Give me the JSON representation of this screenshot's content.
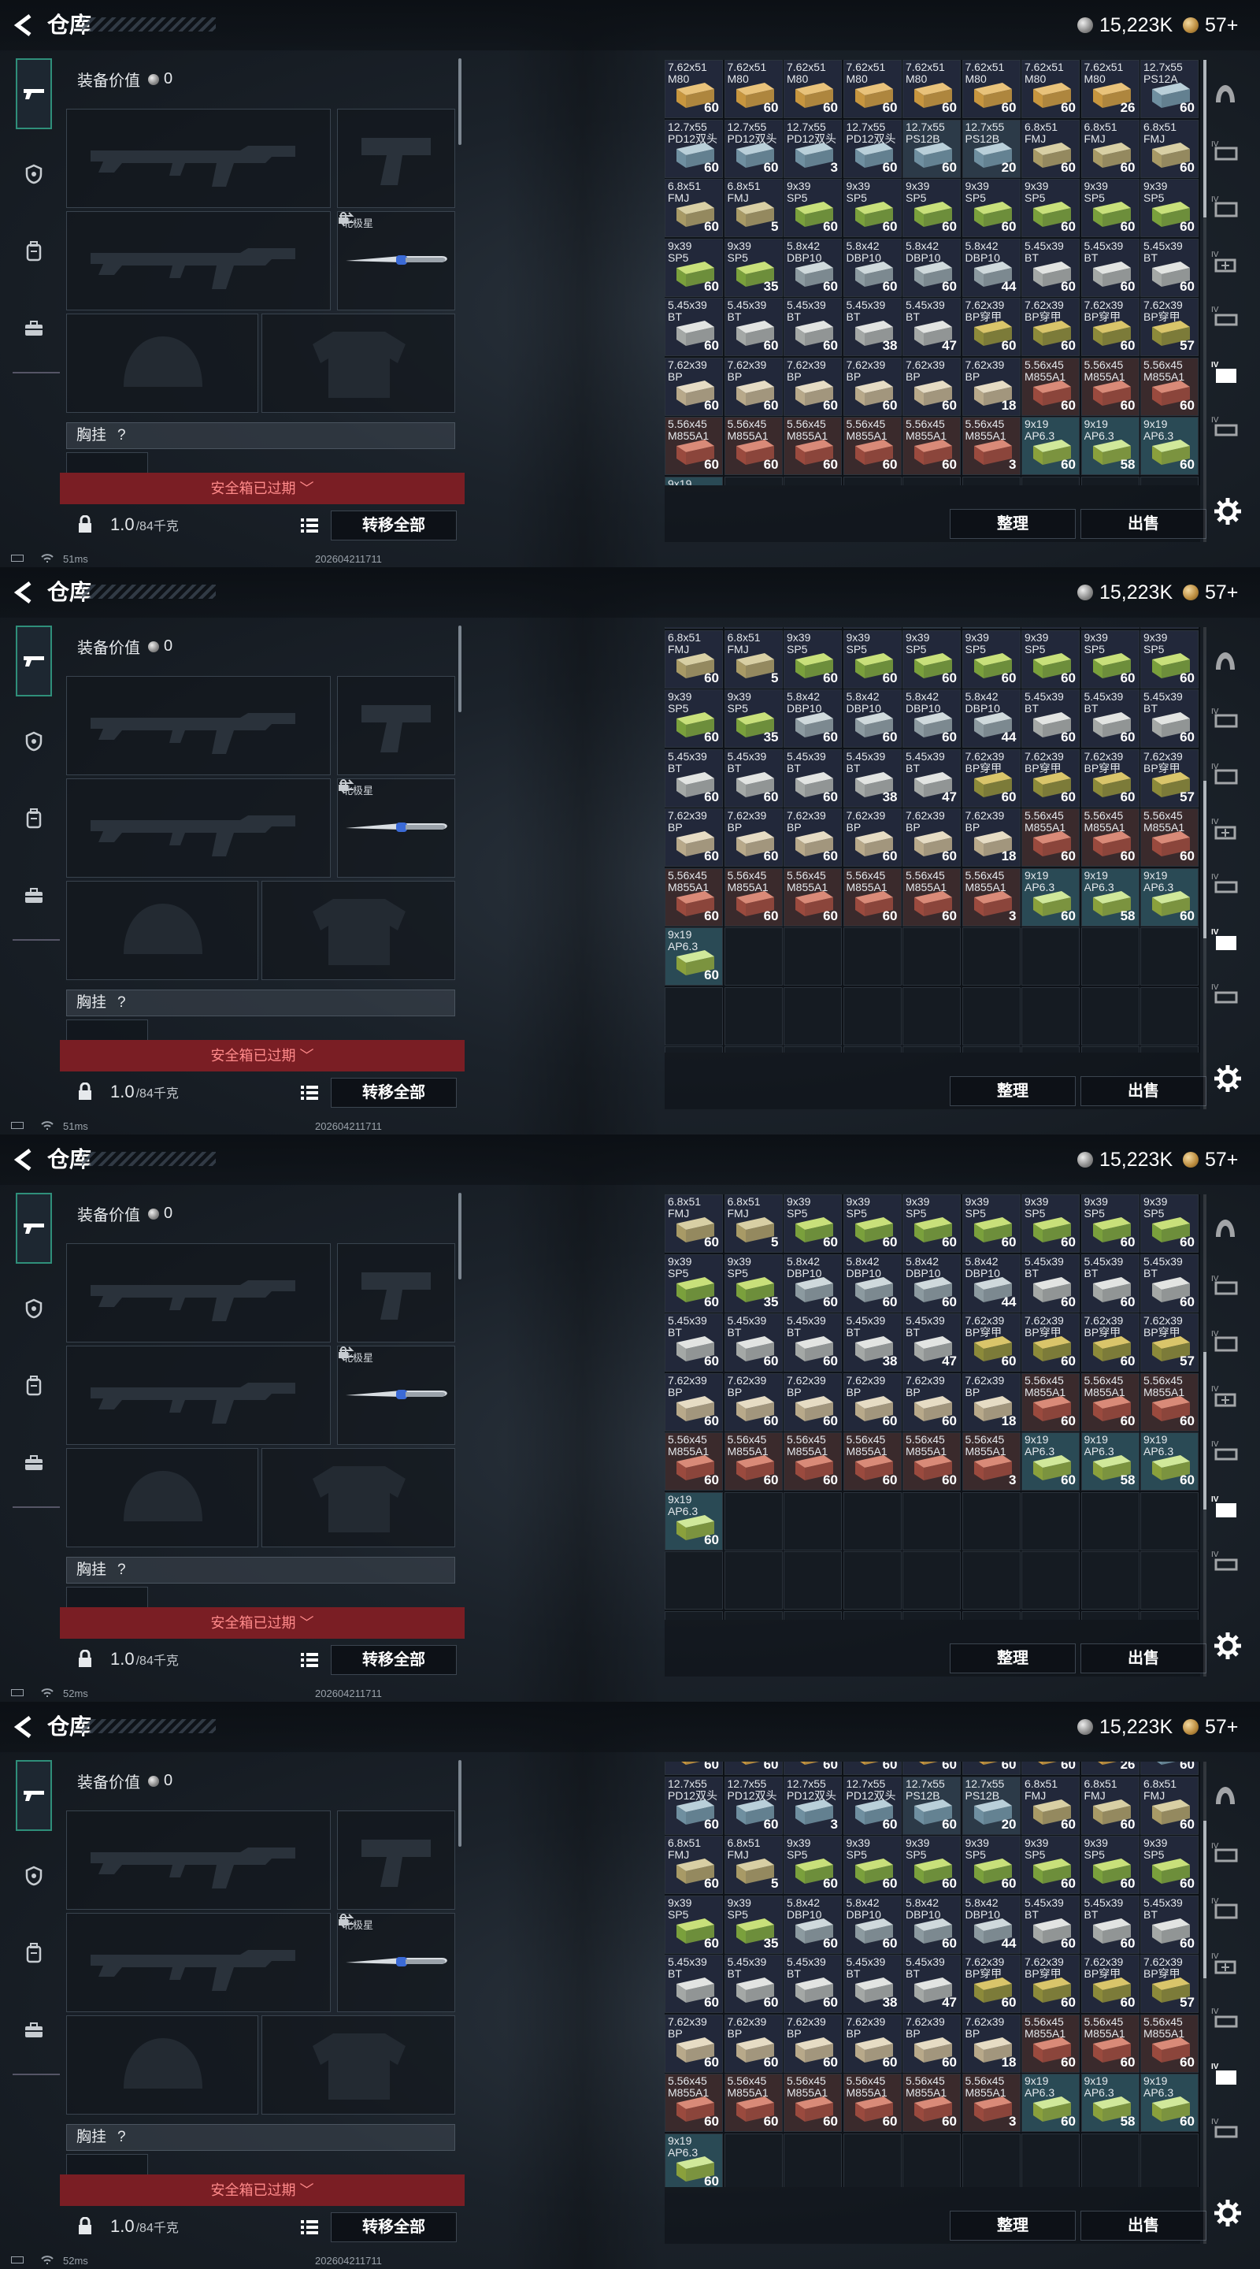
{
  "app": {
    "title": "仓库",
    "currency_silver": "15,223K",
    "currency_gold": "57+"
  },
  "loadout": {
    "equip_value_label": "装备价值",
    "equip_value": "0",
    "melee_name": "北极星",
    "rig_label": "胸挂",
    "rig_unknown": "?",
    "safe_box_expired": "安全箱已过期",
    "weight": "1.0",
    "weight_max": "/84千克",
    "move_all": "转移全部"
  },
  "stash": {
    "sort_label": "整理",
    "sell_label": "出售"
  },
  "frames": [
    {
      "ping": "51ms",
      "timestamp": "202604211711"
    },
    {
      "ping": "51ms",
      "timestamp": "202604211711"
    },
    {
      "ping": "52ms",
      "timestamp": "202604211711"
    },
    {
      "ping": "52ms",
      "timestamp": "202604211711"
    }
  ],
  "icons": [
    "back-arrow-icon",
    "silver-coin-icon",
    "gold-coin-icon",
    "weapon-tab-icon",
    "armor-tab-icon",
    "backpack-tab-icon",
    "case-tab-icon",
    "lock-icon",
    "swap-icon",
    "list-icon",
    "gear-icon",
    "wifi-icon",
    "battery-icon"
  ],
  "colors": {
    "accent_teal": "#2f8f7a",
    "expired_red": "#7a1e24"
  },
  "ammo_rows": [
    [
      {
        "n": "7.62x51 M80",
        "c": "60"
      },
      {
        "n": "7.62x51 M80",
        "c": "60"
      },
      {
        "n": "7.62x51 M80",
        "c": "60"
      },
      {
        "n": "7.62x51 M80",
        "c": "60"
      },
      {
        "n": "7.62x51 M80",
        "c": "60"
      },
      {
        "n": "7.62x51 M80",
        "c": "60"
      },
      {
        "n": "7.62x51 M80",
        "c": "60"
      },
      {
        "n": "7.62x51 M80",
        "c": "26"
      },
      {
        "n": "12.7x55 PS12A",
        "c": "60"
      }
    ],
    [
      {
        "n": "12.7x55 PD12双头",
        "c": "60"
      },
      {
        "n": "12.7x55 PD12双头",
        "c": "60"
      },
      {
        "n": "12.7x55 PD12双头",
        "c": "3"
      },
      {
        "n": "12.7x55 PD12双头",
        "c": "60"
      },
      {
        "n": "12.7x55 PS12B",
        "c": "60"
      },
      {
        "n": "12.7x55 PS12B",
        "c": "20"
      },
      {
        "n": "6.8x51 FMJ",
        "c": "60"
      },
      {
        "n": "6.8x51 FMJ",
        "c": "60"
      },
      {
        "n": "6.8x51 FMJ",
        "c": "60"
      }
    ],
    [
      {
        "n": "6.8x51 FMJ",
        "c": "60"
      },
      {
        "n": "6.8x51 FMJ",
        "c": "5"
      },
      {
        "n": "9x39 SP5",
        "c": "60"
      },
      {
        "n": "9x39 SP5",
        "c": "60"
      },
      {
        "n": "9x39 SP5",
        "c": "60"
      },
      {
        "n": "9x39 SP5",
        "c": "60"
      },
      {
        "n": "9x39 SP5",
        "c": "60"
      },
      {
        "n": "9x39 SP5",
        "c": "60"
      },
      {
        "n": "9x39 SP5",
        "c": "60"
      }
    ],
    [
      {
        "n": "9x39 SP5",
        "c": "60"
      },
      {
        "n": "9x39 SP5",
        "c": "35"
      },
      {
        "n": "5.8x42 DBP10",
        "c": "60"
      },
      {
        "n": "5.8x42 DBP10",
        "c": "60"
      },
      {
        "n": "5.8x42 DBP10",
        "c": "60"
      },
      {
        "n": "5.8x42 DBP10",
        "c": "44"
      },
      {
        "n": "5.45x39 BT",
        "c": "60"
      },
      {
        "n": "5.45x39 BT",
        "c": "60"
      },
      {
        "n": "5.45x39 BT",
        "c": "60"
      }
    ],
    [
      {
        "n": "5.45x39 BT",
        "c": "60"
      },
      {
        "n": "5.45x39 BT",
        "c": "60"
      },
      {
        "n": "5.45x39 BT",
        "c": "60"
      },
      {
        "n": "5.45x39 BT",
        "c": "38"
      },
      {
        "n": "5.45x39 BT",
        "c": "47"
      },
      {
        "n": "7.62x39 BP穿甲",
        "c": "60"
      },
      {
        "n": "7.62x39 BP穿甲",
        "c": "60"
      },
      {
        "n": "7.62x39 BP穿甲",
        "c": "60"
      },
      {
        "n": "7.62x39 BP穿甲",
        "c": "57"
      }
    ],
    [
      {
        "n": "7.62x39 BP",
        "c": "60"
      },
      {
        "n": "7.62x39 BP",
        "c": "60"
      },
      {
        "n": "7.62x39 BP",
        "c": "60"
      },
      {
        "n": "7.62x39 BP",
        "c": "60"
      },
      {
        "n": "7.62x39 BP",
        "c": "60"
      },
      {
        "n": "7.62x39 BP",
        "c": "18"
      },
      {
        "n": "5.56x45 M855A1",
        "c": "60"
      },
      {
        "n": "5.56x45 M855A1",
        "c": "60"
      },
      {
        "n": "5.56x45 M855A1",
        "c": "60"
      }
    ],
    [
      {
        "n": "5.56x45 M855A1",
        "c": "60"
      },
      {
        "n": "5.56x45 M855A1",
        "c": "60"
      },
      {
        "n": "5.56x45 M855A1",
        "c": "60"
      },
      {
        "n": "5.56x45 M855A1",
        "c": "60"
      },
      {
        "n": "5.56x45 M855A1",
        "c": "60"
      },
      {
        "n": "5.56x45 M855A1",
        "c": "3"
      },
      {
        "n": "9x19 AP6.3",
        "c": "60"
      },
      {
        "n": "9x19 AP6.3",
        "c": "58"
      },
      {
        "n": "9x19 AP6.3",
        "c": "60"
      }
    ],
    [
      {
        "n": "9x19 AP6.3",
        "c": "60"
      }
    ]
  ],
  "frame_scroll_rows": [
    0,
    1.95,
    2.0,
    0.75
  ]
}
